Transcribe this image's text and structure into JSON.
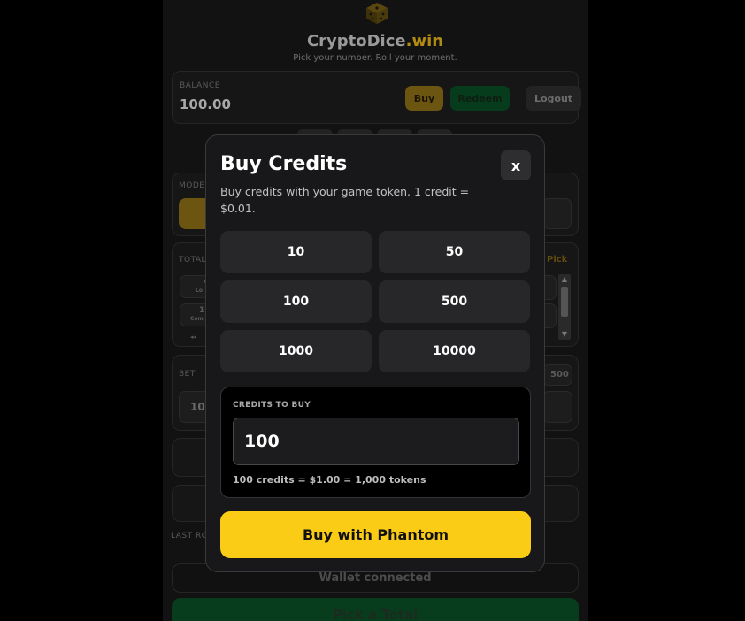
{
  "header": {
    "brand_name": "CryptoDice",
    "brand_tld": ".win",
    "tagline": "Pick your number. Roll your moment."
  },
  "balance": {
    "label": "BALANCE",
    "value": "100.00",
    "buy_label": "Buy",
    "redeem_label": "Redeem",
    "logout_label": "Logout"
  },
  "background": {
    "mode_label": "MODE",
    "total_label": "TOTAL",
    "pick_label": "Pick",
    "bet_label": "BET",
    "bet_value": "10",
    "bet_max": "500",
    "total_items": [
      {
        "value": "4",
        "sub": "Lo"
      },
      {
        "value": "11",
        "sub": "Com"
      },
      {
        "value": "◂◂",
        "sub": ""
      }
    ],
    "last_rolls_label": "LAST RO",
    "wallet_status": "Wallet connected",
    "pick_total_button": "Pick a Total"
  },
  "modal": {
    "title": "Buy Credits",
    "close_label": "x",
    "description": "Buy credits with your game token. 1 credit = $0.01.",
    "amounts": [
      "10",
      "50",
      "100",
      "500",
      "1000",
      "10000"
    ],
    "credits_label": "CREDITS TO BUY",
    "credits_value": "100",
    "conversion": "100 credits = $1.00 = 1,000 tokens",
    "buy_button": "Buy with Phantom"
  },
  "colors": {
    "accent": "#facc15",
    "modal_bg": "#18181a",
    "page_bg": "#000000"
  }
}
